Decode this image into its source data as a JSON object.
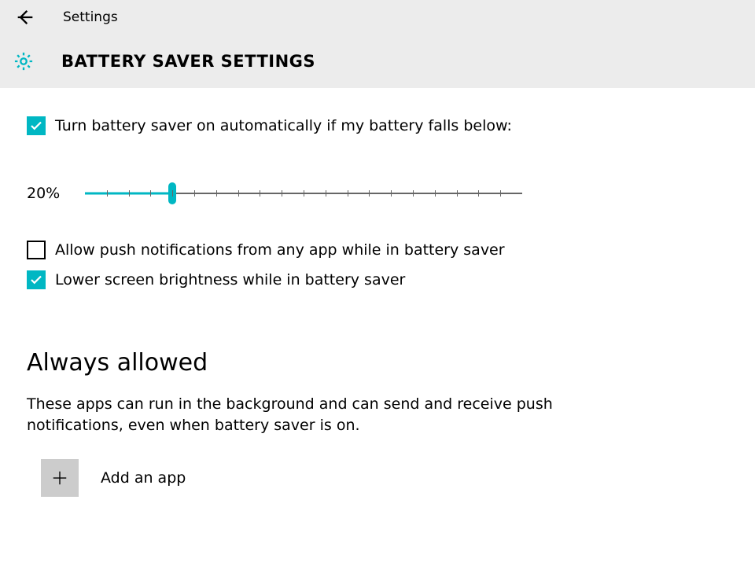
{
  "header": {
    "app_title": "Settings",
    "page_title": "BATTERY SAVER SETTINGS"
  },
  "options": {
    "auto_on": {
      "label": "Turn battery saver on automatically if my battery falls below:",
      "checked": true
    },
    "allow_push": {
      "label": "Allow push notifications from any app while in battery saver",
      "checked": false
    },
    "lower_brightness": {
      "label": "Lower screen brightness while in battery saver",
      "checked": true
    }
  },
  "slider": {
    "value_label": "20%",
    "percent": 20
  },
  "always_allowed": {
    "title": "Always allowed",
    "description": "These apps can run in the background and can send and receive push notifications, even when battery saver is on.",
    "add_label": "Add an app"
  },
  "colors": {
    "accent": "#00b7c3"
  }
}
